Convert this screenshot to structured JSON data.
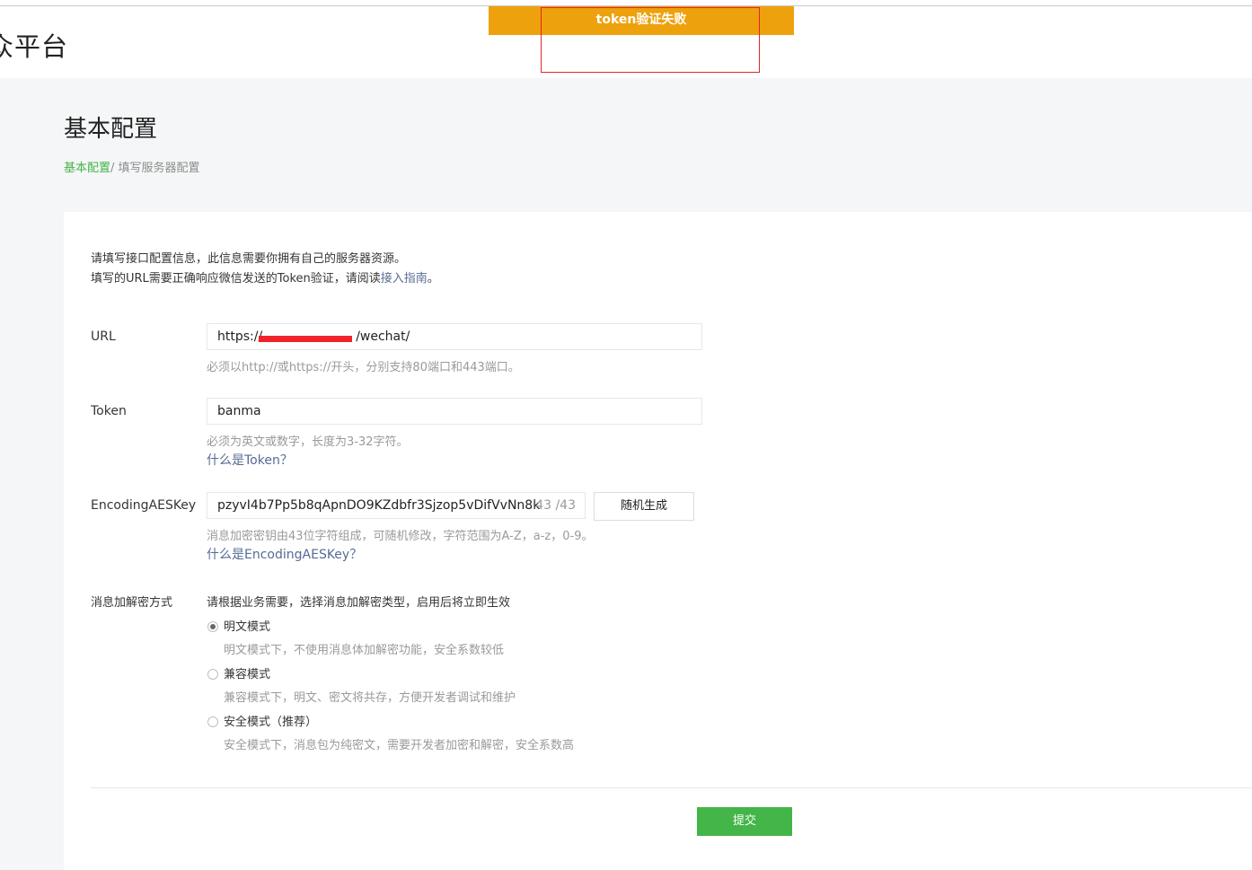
{
  "header": {
    "logo_text": "众平台",
    "toast": "token验证失败"
  },
  "page": {
    "title": "基本配置",
    "breadcrumb_link": "基本配置",
    "breadcrumb_current": "/ 填写服务器配置"
  },
  "intro": {
    "line1": "请填写接口配置信息，此信息需要你拥有自己的服务器资源。",
    "line2_prefix": "填写的URL需要正确响应微信发送的Token验证，请阅读",
    "line2_link": "接入指南",
    "line2_suffix": "。"
  },
  "form": {
    "url": {
      "label": "URL",
      "value_prefix": "https://",
      "value_suffix": "/wechat/",
      "hint": "必须以http://或https://开头，分别支持80端口和443端口。"
    },
    "token": {
      "label": "Token",
      "value": "banma",
      "hint": "必须为英文或数字，长度为3-32字符。",
      "help_link": "什么是Token？"
    },
    "aeskey": {
      "label": "EncodingAESKey",
      "value": "pzyvI4b7Pp5b8qApnDO9KZdbfr3Sjzop5vDifVvNn8k",
      "counter": "43 /43",
      "generate_button": "随机生成",
      "hint": "消息加密密钥由43位字符组成，可随机修改，字符范围为A-Z，a-z，0-9。",
      "help_link": "什么是EncodingAESKey？"
    },
    "encryption": {
      "label": "消息加解密方式",
      "description": "请根据业务需要，选择消息加解密类型，启用后将立即生效",
      "options": [
        {
          "label": "明文模式",
          "desc": "明文模式下，不使用消息体加解密功能，安全系数较低",
          "checked": true
        },
        {
          "label": "兼容模式",
          "desc": "兼容模式下，明文、密文将共存，方便开发者调试和维护",
          "checked": false
        },
        {
          "label": "安全模式（推荐）",
          "desc": "安全模式下，消息包为纯密文，需要开发者加密和解密，安全系数高",
          "checked": false
        }
      ]
    },
    "submit_button": "提交"
  },
  "colors": {
    "toast": "#eda10c",
    "primary": "#44b549",
    "link": "#576b95",
    "redaction": "#f2222b"
  }
}
